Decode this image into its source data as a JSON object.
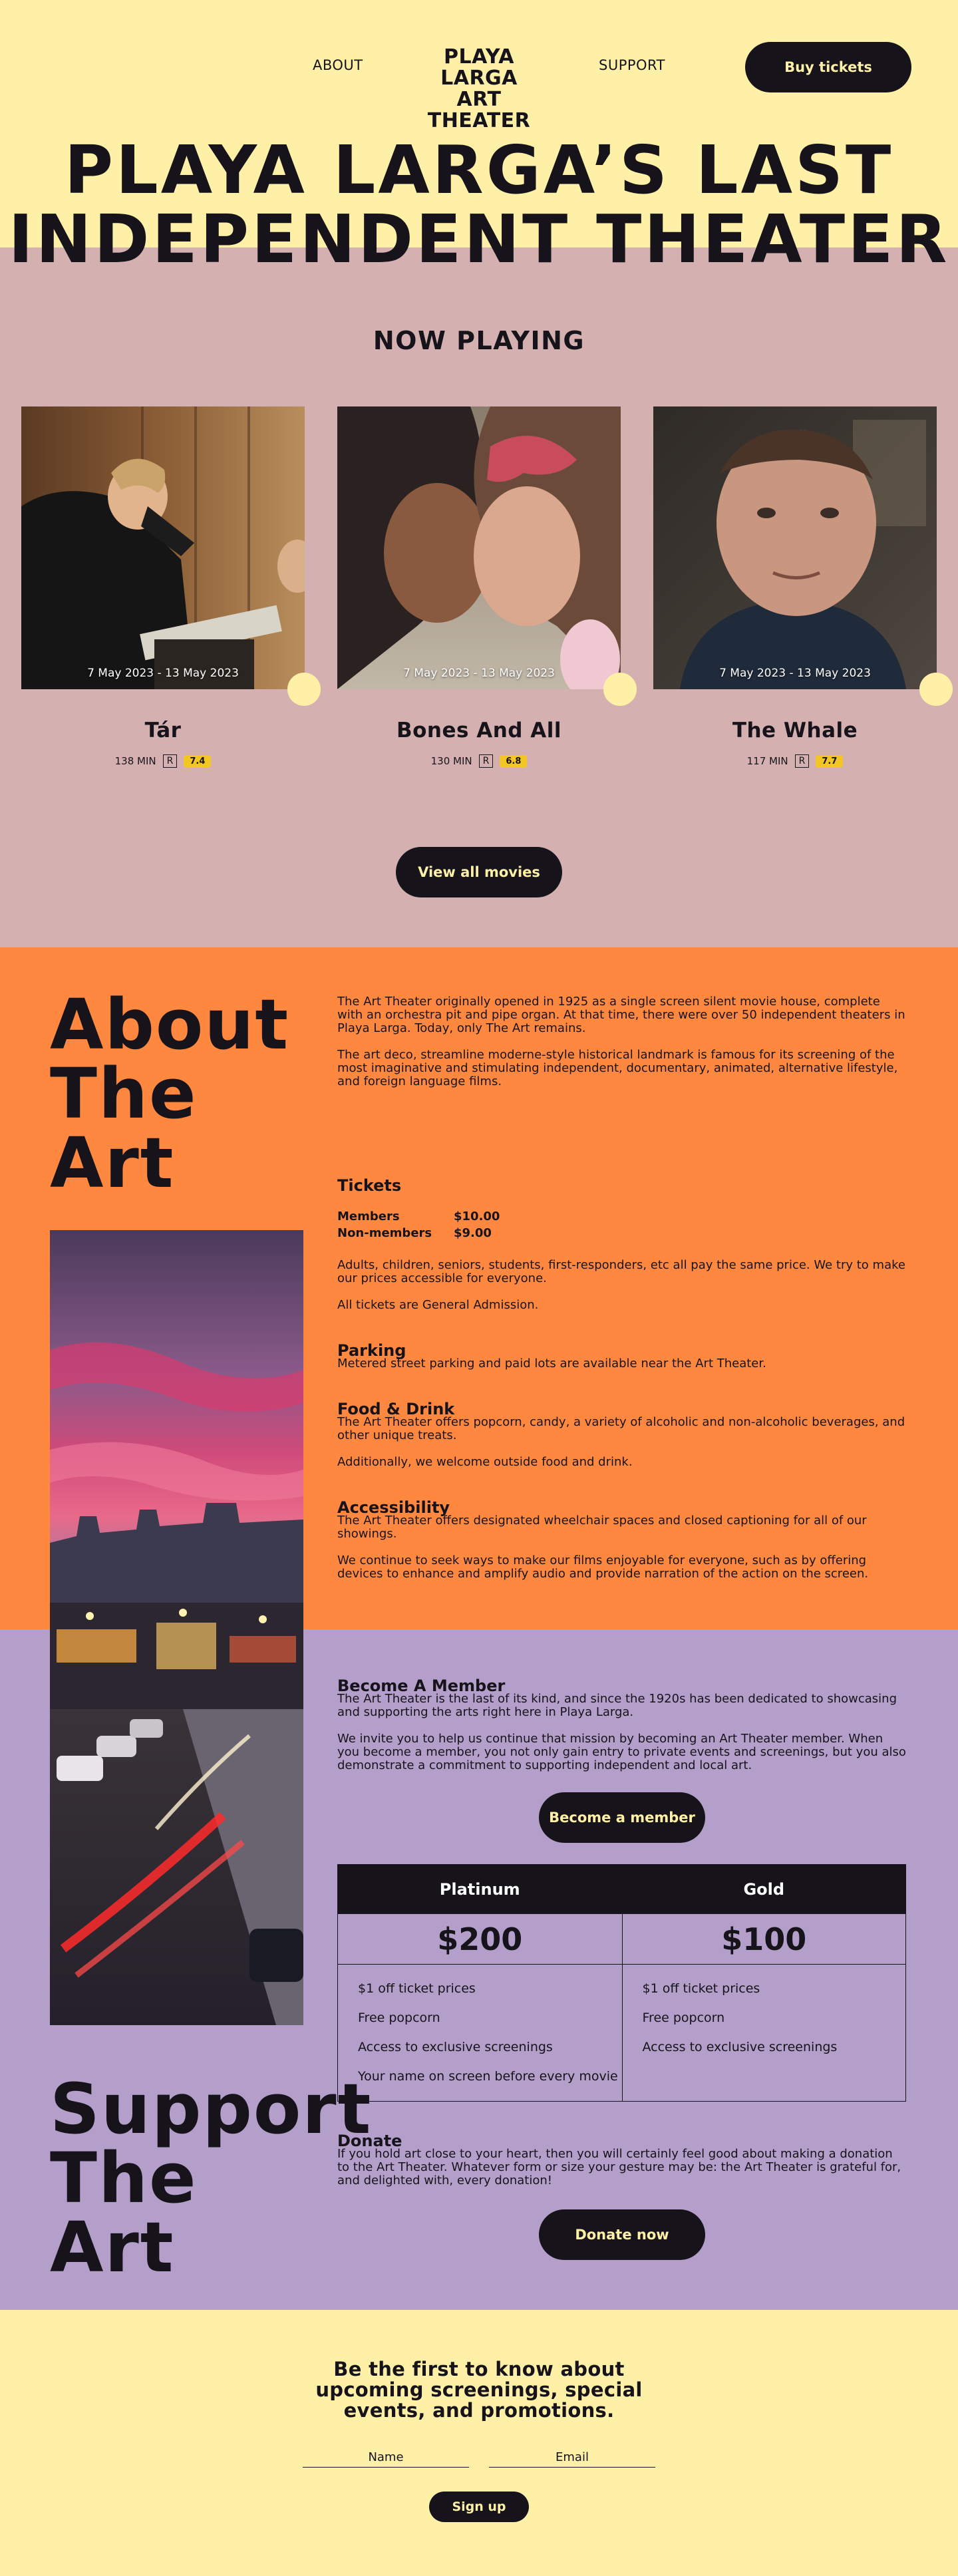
{
  "nav": {
    "about": "ABOUT",
    "support": "SUPPORT",
    "logo_line1": "PLAYA LARGA",
    "logo_line2": "ART THEATER",
    "buy_tickets": "Buy tickets"
  },
  "hero": {
    "title_line1": "PLAYA LARGA’S LAST",
    "title_line2": "INDEPENDENT THEATER"
  },
  "now_playing": {
    "heading": "NOW PLAYING",
    "movies": [
      {
        "title": "Tár",
        "dates": "7 May 2023 - 13 May 2023",
        "runtime": "138 MIN",
        "rating": "R",
        "score": "7.4"
      },
      {
        "title": "Bones And All",
        "dates": "7 May 2023 - 13 May 2023",
        "runtime": "130 MIN",
        "rating": "R",
        "score": "6.8"
      },
      {
        "title": "The Whale",
        "dates": "7 May 2023 - 13 May 2023",
        "runtime": "117 MIN",
        "rating": "R",
        "score": "7.7"
      }
    ],
    "view_all": "View all movies"
  },
  "about": {
    "heading_l1": "About",
    "heading_l2": "The",
    "heading_l3": "Art",
    "intro_p1": "The Art Theater originally opened in 1925 as a single screen silent movie house, complete with an orchestra pit and pipe organ. At that time, there were over 50 independent theaters in Playa Larga. Today, only The Art remains.",
    "intro_p2": "The art deco, streamline moderne-style historical landmark is famous for its screening of the most imaginative and stimulating independent, documentary, animated, alternative lifestyle, and foreign language films.",
    "tickets_h": "Tickets",
    "members_label": "Members",
    "members_price": "$10.00",
    "nonmembers_label": "Non-members",
    "nonmembers_price": "$9.00",
    "tickets_p1": "Adults, children, seniors, students, first-responders, etc all pay the same price.  We try to make our prices accessible for everyone.",
    "tickets_p2": "All tickets are General Admission.",
    "parking_h": "Parking",
    "parking_p": "Metered street parking and paid lots are available near the Art Theater.",
    "food_h": "Food & Drink",
    "food_p1": "The Art Theater offers popcorn, candy, a variety of alcoholic and non-alcoholic beverages, and other unique treats.",
    "food_p2": "Additionally, we welcome outside food and drink.",
    "access_h": "Accessibility",
    "access_p1": "The Art Theater offers designated wheelchair spaces and closed captioning for all of our showings.",
    "access_p2": "We continue to seek ways to make our films enjoyable for everyone, such as by offering devices to enhance and amplify audio and provide narration of the action on the screen."
  },
  "support": {
    "heading_l1": "Support",
    "heading_l2": "The",
    "heading_l3": "Art",
    "member_h": "Become A Member",
    "member_p1": "The Art Theater is the last of its kind, and since the 1920s has been dedicated to showcasing and supporting the arts right here in Playa Larga.",
    "member_p2": "We invite you to help us continue that mission by becoming an Art Theater member. When you become a member, you not only gain entry to private events and screenings, but you also demonstrate a commitment to supporting independent and local art.",
    "member_button": "Become a member",
    "tiers": [
      {
        "name": "Platinum",
        "price": "$200",
        "perks": [
          "$1 off ticket prices",
          "Free popcorn",
          "Access to exclusive screenings",
          "Your name on screen before every movie"
        ]
      },
      {
        "name": "Gold",
        "price": "$100",
        "perks": [
          "$1 off ticket prices",
          "Free popcorn",
          "Access to exclusive screenings"
        ]
      }
    ],
    "donate_h": "Donate",
    "donate_p": "If you hold art close to your heart, then you will certainly feel good about making a donation to the Art Theater. Whatever form or size your gesture may be: the Art Theater is grateful for, and delighted with, every donation!",
    "donate_button": "Donate now"
  },
  "newsletter": {
    "title": "Be the first to know about upcoming screenings, special events, and promotions.",
    "name_placeholder": "Name",
    "email_placeholder": "Email",
    "signup": "Sign up"
  },
  "colors": {
    "yellow": "#fff0a8",
    "rose": "#d5b0b0",
    "orange": "#ff8840",
    "lavender": "#b39fc9",
    "ink": "#16141a",
    "score_badge": "#f2c624"
  }
}
